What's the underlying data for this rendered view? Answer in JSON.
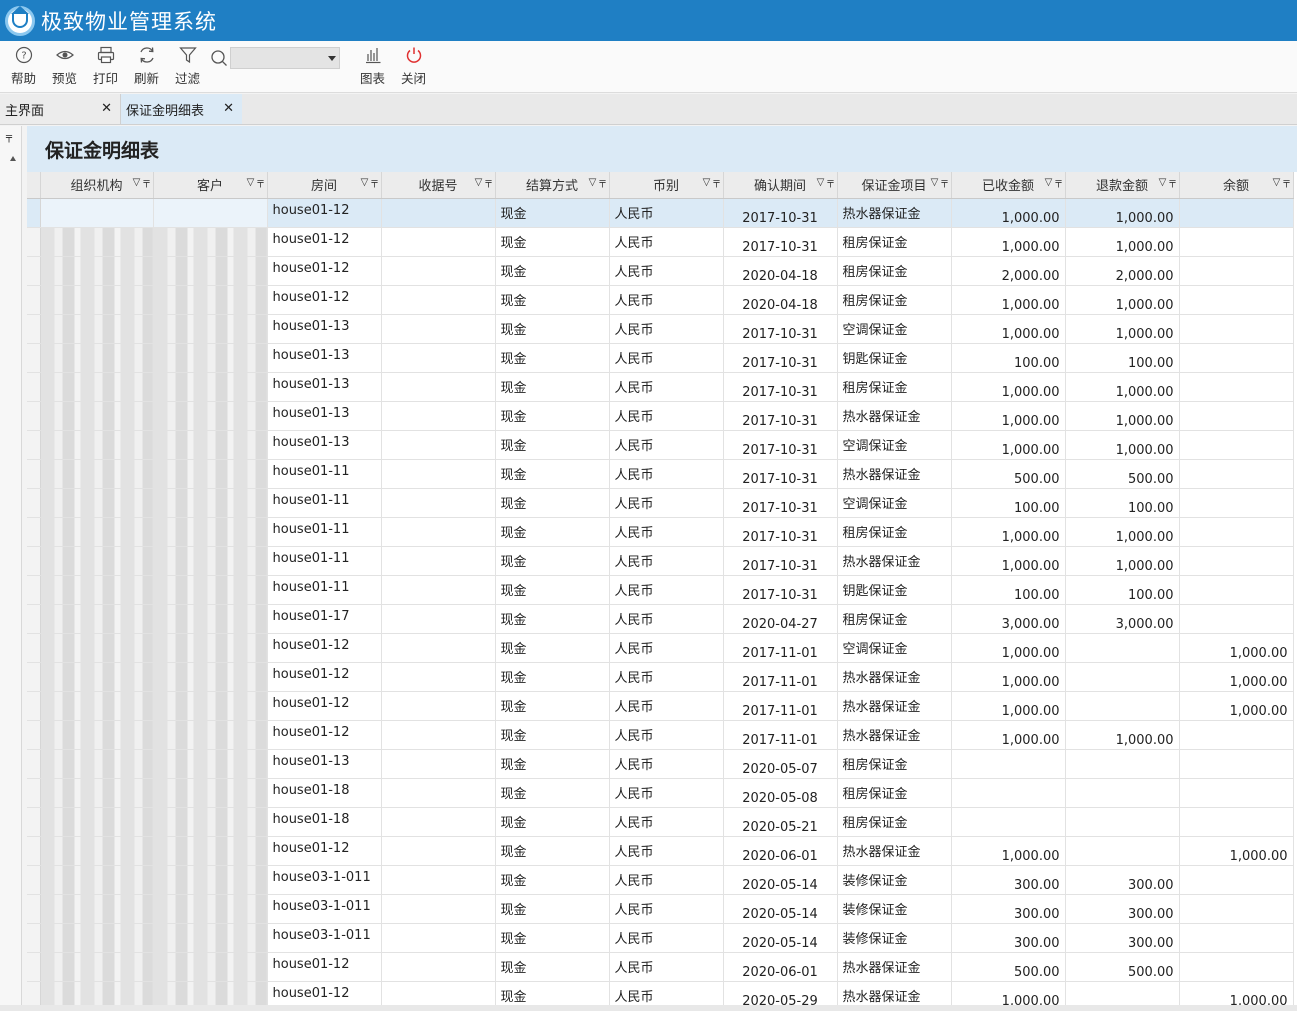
{
  "app": {
    "title": "极致物业管理系统"
  },
  "toolbar": {
    "help": "帮助",
    "preview": "预览",
    "print": "打印",
    "refresh": "刷新",
    "filter": "过滤",
    "chart": "图表",
    "close": "关闭",
    "search_value": ""
  },
  "tabs": [
    {
      "label": "主界面"
    },
    {
      "label": "保证金明细表"
    }
  ],
  "report": {
    "title": "保证金明细表",
    "columns": [
      "组织机构",
      "客户",
      "房间",
      "收据号",
      "结算方式",
      "币别",
      "确认期间",
      "保证金项目",
      "已收金额",
      "退款金额",
      "余额"
    ],
    "rows": [
      [
        "",
        "",
        "house01-12",
        "",
        "现金",
        "人民币",
        "2017-10-31",
        "热水器保证金",
        "1,000.00",
        "1,000.00",
        ""
      ],
      [
        "",
        "",
        "house01-12",
        "",
        "现金",
        "人民币",
        "2017-10-31",
        "租房保证金",
        "1,000.00",
        "1,000.00",
        ""
      ],
      [
        "",
        "",
        "house01-12",
        "",
        "现金",
        "人民币",
        "2020-04-18",
        "租房保证金",
        "2,000.00",
        "2,000.00",
        ""
      ],
      [
        "",
        "",
        "house01-12",
        "",
        "现金",
        "人民币",
        "2020-04-18",
        "租房保证金",
        "1,000.00",
        "1,000.00",
        ""
      ],
      [
        "",
        "",
        "house01-13",
        "",
        "现金",
        "人民币",
        "2017-10-31",
        "空调保证金",
        "1,000.00",
        "1,000.00",
        ""
      ],
      [
        "",
        "",
        "house01-13",
        "",
        "现金",
        "人民币",
        "2017-10-31",
        "钥匙保证金",
        "100.00",
        "100.00",
        ""
      ],
      [
        "",
        "",
        "house01-13",
        "",
        "现金",
        "人民币",
        "2017-10-31",
        "租房保证金",
        "1,000.00",
        "1,000.00",
        ""
      ],
      [
        "",
        "",
        "house01-13",
        "",
        "现金",
        "人民币",
        "2017-10-31",
        "热水器保证金",
        "1,000.00",
        "1,000.00",
        ""
      ],
      [
        "",
        "",
        "house01-13",
        "",
        "现金",
        "人民币",
        "2017-10-31",
        "空调保证金",
        "1,000.00",
        "1,000.00",
        ""
      ],
      [
        "",
        "",
        "house01-11",
        "",
        "现金",
        "人民币",
        "2017-10-31",
        "热水器保证金",
        "500.00",
        "500.00",
        ""
      ],
      [
        "",
        "",
        "house01-11",
        "",
        "现金",
        "人民币",
        "2017-10-31",
        "空调保证金",
        "100.00",
        "100.00",
        ""
      ],
      [
        "",
        "",
        "house01-11",
        "",
        "现金",
        "人民币",
        "2017-10-31",
        "租房保证金",
        "1,000.00",
        "1,000.00",
        ""
      ],
      [
        "",
        "",
        "house01-11",
        "",
        "现金",
        "人民币",
        "2017-10-31",
        "热水器保证金",
        "1,000.00",
        "1,000.00",
        ""
      ],
      [
        "",
        "",
        "house01-11",
        "",
        "现金",
        "人民币",
        "2017-10-31",
        "钥匙保证金",
        "100.00",
        "100.00",
        ""
      ],
      [
        "",
        "",
        "house01-17",
        "",
        "现金",
        "人民币",
        "2020-04-27",
        "租房保证金",
        "3,000.00",
        "3,000.00",
        ""
      ],
      [
        "",
        "",
        "house01-12",
        "",
        "现金",
        "人民币",
        "2017-11-01",
        "空调保证金",
        "1,000.00",
        "",
        "1,000.00"
      ],
      [
        "",
        "",
        "house01-12",
        "",
        "现金",
        "人民币",
        "2017-11-01",
        "热水器保证金",
        "1,000.00",
        "",
        "1,000.00"
      ],
      [
        "",
        "",
        "house01-12",
        "",
        "现金",
        "人民币",
        "2017-11-01",
        "热水器保证金",
        "1,000.00",
        "",
        "1,000.00"
      ],
      [
        "",
        "",
        "house01-12",
        "",
        "现金",
        "人民币",
        "2017-11-01",
        "热水器保证金",
        "1,000.00",
        "1,000.00",
        ""
      ],
      [
        "",
        "",
        "house01-13",
        "",
        "现金",
        "人民币",
        "2020-05-07",
        "租房保证金",
        "",
        "",
        ""
      ],
      [
        "",
        "",
        "house01-18",
        "",
        "现金",
        "人民币",
        "2020-05-08",
        "租房保证金",
        "",
        "",
        ""
      ],
      [
        "",
        "",
        "house01-18",
        "",
        "现金",
        "人民币",
        "2020-05-21",
        "租房保证金",
        "",
        "",
        ""
      ],
      [
        "",
        "",
        "house01-12",
        "",
        "现金",
        "人民币",
        "2020-06-01",
        "热水器保证金",
        "1,000.00",
        "",
        "1,000.00"
      ],
      [
        "",
        "",
        "house03-1-011",
        "",
        "现金",
        "人民币",
        "2020-05-14",
        "装修保证金",
        "300.00",
        "300.00",
        ""
      ],
      [
        "",
        "",
        "house03-1-011",
        "",
        "现金",
        "人民币",
        "2020-05-14",
        "装修保证金",
        "300.00",
        "300.00",
        ""
      ],
      [
        "",
        "",
        "house03-1-011",
        "",
        "现金",
        "人民币",
        "2020-05-14",
        "装修保证金",
        "300.00",
        "300.00",
        ""
      ],
      [
        "",
        "",
        "house01-12",
        "",
        "现金",
        "人民币",
        "2020-06-01",
        "热水器保证金",
        "500.00",
        "500.00",
        ""
      ],
      [
        "",
        "",
        "house01-12",
        "",
        "现金",
        "人民币",
        "2020-05-29",
        "热水器保证金",
        "1,000.00",
        "",
        "1,000.00"
      ]
    ]
  },
  "colors": {
    "titlebar": "#1f7fc4",
    "selected_row": "#dbeaf6",
    "close_icon": "#e03030"
  },
  "icons": [
    "help-icon",
    "preview-icon",
    "print-icon",
    "refresh-icon",
    "filter-icon",
    "search-icon",
    "chart-icon",
    "power-icon"
  ]
}
